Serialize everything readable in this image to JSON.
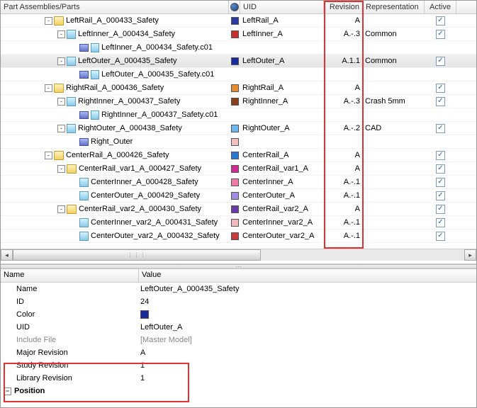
{
  "headers": {
    "parts": "Part Assemblies/Parts",
    "uid": "UID",
    "revision": "Revision",
    "representation": "Representation",
    "active": "Active"
  },
  "rows": [
    {
      "indent": 62,
      "expander": "-",
      "icon": "folder",
      "label": "LeftRail_A_000433_Safety",
      "color": "#2b3aa2",
      "uid": "LeftRail_A",
      "rev": "A",
      "rep": "",
      "active": true
    },
    {
      "indent": 80,
      "expander": "-",
      "icon": "cube",
      "label": "LeftInner_A_000434_Safety",
      "color": "#c72f2f",
      "uid": "LeftInner_A",
      "rev": "A.-.3",
      "rep": "Common",
      "active": true
    },
    {
      "indent": 98,
      "expander": "",
      "icon": "surf2",
      "label": "LeftInner_A_000434_Safety.c01",
      "color": "",
      "uid": "",
      "rev": "",
      "rep": "",
      "active": null
    },
    {
      "indent": 80,
      "expander": "-",
      "icon": "cube",
      "label": "LeftOuter_A_000435_Safety",
      "selected": true,
      "color": "#1a2c9c",
      "uid": "LeftOuter_A",
      "rev": "A.1.1",
      "rep": "Common",
      "active": true
    },
    {
      "indent": 98,
      "expander": "",
      "icon": "surf2",
      "label": "LeftOuter_A_000435_Safety.c01",
      "color": "",
      "uid": "",
      "rev": "",
      "rep": "",
      "active": null
    },
    {
      "indent": 62,
      "expander": "-",
      "icon": "folder",
      "label": "RightRail_A_000436_Safety",
      "color": "#e58a2e",
      "uid": "RightRail_A",
      "rev": "A",
      "rep": "",
      "active": true
    },
    {
      "indent": 80,
      "expander": "-",
      "icon": "cube",
      "label": "RightInner_A_000437_Safety",
      "color": "#8a3e1c",
      "uid": "RightInner_A",
      "rev": "A.-.3",
      "rep": "Crash 5mm",
      "active": true
    },
    {
      "indent": 98,
      "expander": "",
      "icon": "surf2",
      "label": "RightInner_A_000437_Safety.c01",
      "color": "",
      "uid": "",
      "rev": "",
      "rep": "",
      "active": null
    },
    {
      "indent": 80,
      "expander": "-",
      "icon": "cube",
      "label": "RightOuter_A_000438_Safety",
      "color": "#6bb7ee",
      "uid": "RightOuter_A",
      "rev": "A.-.2",
      "rep": "CAD",
      "active": true
    },
    {
      "indent": 98,
      "expander": "",
      "icon": "surf",
      "label": "Right_Outer",
      "color": "#f2c0c0",
      "uid": "",
      "rev": "",
      "rep": "",
      "active": null
    },
    {
      "indent": 62,
      "expander": "-",
      "icon": "folder",
      "label": "CenterRail_A_000426_Safety",
      "color": "#2b77d4",
      "uid": "CenterRail_A",
      "rev": "A",
      "rep": "",
      "active": true
    },
    {
      "indent": 80,
      "expander": "-",
      "icon": "folder",
      "label": "CenterRail_var1_A_000427_Safety",
      "color": "#d02894",
      "uid": "CenterRail_var1_A",
      "rev": "A",
      "rep": "",
      "active": true
    },
    {
      "indent": 98,
      "expander": "",
      "icon": "cube",
      "label": "CenterInner_A_000428_Safety",
      "color": "#f07aa8",
      "uid": "CenterInner_A",
      "rev": "A.-.1",
      "rep": "",
      "active": true
    },
    {
      "indent": 98,
      "expander": "",
      "icon": "cube",
      "label": "CenterOuter_A_000429_Safety",
      "color": "#a289e2",
      "uid": "CenterOuter_A",
      "rev": "A.-.1",
      "rep": "",
      "active": true
    },
    {
      "indent": 80,
      "expander": "-",
      "icon": "folder",
      "label": "CenterRail_var2_A_000430_Safety",
      "color": "#6a3aa6",
      "uid": "CenterRail_var2_A",
      "rev": "A",
      "rep": "",
      "active": true
    },
    {
      "indent": 98,
      "expander": "",
      "icon": "cube",
      "label": "CenterInner_var2_A_000431_Safety",
      "color": "#f4b9b9",
      "uid": "CenterInner_var2_A",
      "rev": "A.-.1",
      "rep": "",
      "active": true
    },
    {
      "indent": 98,
      "expander": "",
      "icon": "cube",
      "label": "CenterOuter_var2_A_000432_Safety",
      "color": "#c73b3b",
      "uid": "CenterOuter_var2_A",
      "rev": "A.-.1",
      "rep": "",
      "active": true
    }
  ],
  "properties": {
    "header_name": "Name",
    "header_value": "Value",
    "name_label": "Name",
    "name_value": "LeftOuter_A_000435_Safety",
    "id_label": "ID",
    "id_value": "24",
    "color_label": "Color",
    "color_value": "#1a2c9c",
    "uid_label": "UID",
    "uid_value": "LeftOuter_A",
    "include_label": "Include File",
    "include_value": "[Master Model]",
    "major_label": "Major Revision",
    "major_value": "A",
    "study_label": "Study Revision",
    "study_value": "1",
    "library_label": "Library Revision",
    "library_value": "1",
    "position_label": "Position"
  }
}
